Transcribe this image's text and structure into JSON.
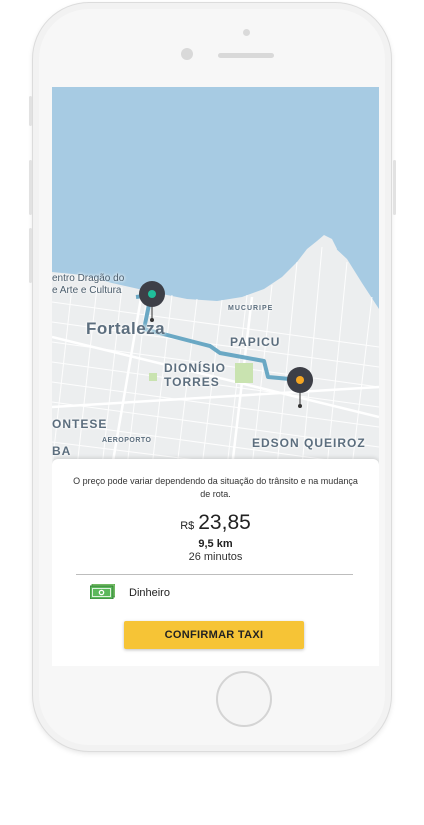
{
  "map": {
    "labels": {
      "centro": "entro Dragão do",
      "arte": "e Arte e Cultura",
      "mucuripe": "MUCURIPE",
      "fortaleza": "Fortaleza",
      "papicu": "PAPICU",
      "dionisio": "DIONÍSIO",
      "torres": "TORRES",
      "montese": "ONTESE",
      "aeroporto": "AEROPORTO",
      "edson": "EDSON QUEIROZ",
      "ba": "BA"
    },
    "route_color": "#6aa8c4",
    "origin_dot_color": "#1fbf9b",
    "destination_dot_color": "#f5a623",
    "water_color": "#a7cbe3",
    "land_color": "#eceeef"
  },
  "trip": {
    "note": "O preço pode variar dependendo da situação do trânsito e na mudança de rota.",
    "currency": "R$",
    "price": "23,85",
    "distance": "9,5 km",
    "duration": "26 minutos"
  },
  "payment": {
    "icon": "cash-icon",
    "method": "Dinheiro"
  },
  "actions": {
    "confirm_label": "CONFIRMAR TAXI",
    "confirm_color": "#f6c436"
  }
}
